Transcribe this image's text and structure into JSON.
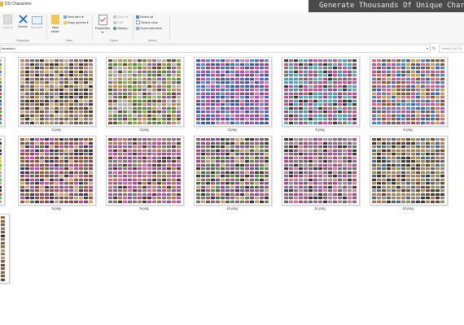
{
  "window": {
    "title": "DS Characters"
  },
  "banner": {
    "text": "Generate Thousands Of Unique Chara"
  },
  "ribbon": {
    "copy_to": "Copy to",
    "delete": "Delete",
    "rename": "Rename",
    "new_folder": "New folder",
    "new_item": "New item",
    "easy_access": "Easy access",
    "properties": "Properties",
    "open": "Open",
    "edit": "Edit",
    "history": "History",
    "select_all": "Select all",
    "select_none": "Select none",
    "invert_selection": "Invert selection",
    "groups": {
      "organize": "Organize",
      "new": "New",
      "open": "Open",
      "select": "Select"
    }
  },
  "address": {
    "path": "haracters"
  },
  "search": {
    "placeholder": "Search DS Ch"
  },
  "files": [
    {
      "name": "",
      "palette": [
        "#e0b94a",
        "#4a7fd0",
        "#d04a4a",
        "#3ba84a",
        "#bbbbbb",
        "#555555"
      ]
    },
    {
      "name": "2.png",
      "palette": [
        "#b58a5c",
        "#6b6b6b",
        "#3b3b3b",
        "#8f7a9a",
        "#c6a88a",
        "#7a5a3a"
      ]
    },
    {
      "name": "3.png",
      "palette": [
        "#7fb04a",
        "#8a6b9a",
        "#c08a5a",
        "#5a8a4a",
        "#b0b0b0",
        "#6b4a3a"
      ]
    },
    {
      "name": "4.png",
      "palette": [
        "#c04ab0",
        "#4a6bd0",
        "#5a8adb",
        "#8a4a9a",
        "#3a5ab0",
        "#d07ac0"
      ]
    },
    {
      "name": "5.png",
      "palette": [
        "#d04aa0",
        "#7a7a7a",
        "#4a9ad0",
        "#3a3a3a",
        "#a04a8a",
        "#5ab0b0"
      ]
    },
    {
      "name": "6.png",
      "palette": [
        "#c4a05a",
        "#4a8ad0",
        "#d06a8a",
        "#3a6ab0",
        "#8a5a3a",
        "#b05ab0"
      ]
    },
    {
      "name": "",
      "palette": [
        "#e04a4a",
        "#4ad04a",
        "#d0d04a",
        "#4a4ad0",
        "#333333",
        "#aaaaaa"
      ]
    },
    {
      "name": "8.png",
      "palette": [
        "#a05a3a",
        "#6a6a6a",
        "#c04ab0",
        "#8a4a5a",
        "#3a3a5a",
        "#d0a07a"
      ]
    },
    {
      "name": "9.png",
      "palette": [
        "#c04ab0",
        "#b07a5a",
        "#8a5aa0",
        "#7a7a7a",
        "#d06a9a",
        "#5a3a3a"
      ]
    },
    {
      "name": "10.png",
      "palette": [
        "#5a8a5a",
        "#8a4a9a",
        "#c0a07a",
        "#4a6a4a",
        "#a05a8a",
        "#3a3a3a"
      ]
    },
    {
      "name": "11.png",
      "palette": [
        "#8a6a9a",
        "#d07aa0",
        "#6a6a6a",
        "#3a3a3a",
        "#b04a8a",
        "#a08aa0"
      ]
    },
    {
      "name": "12.png",
      "palette": [
        "#9a8a5a",
        "#4a6a8a",
        "#6a4a3a",
        "#8a8a8a",
        "#3a3a3a",
        "#b07a5a"
      ]
    },
    {
      "name": "",
      "palette": [
        "#a0603a",
        "#5a4a3a",
        "#c09a6a",
        "#7a5a4a",
        "#333333",
        "#8a7a6a"
      ]
    }
  ]
}
